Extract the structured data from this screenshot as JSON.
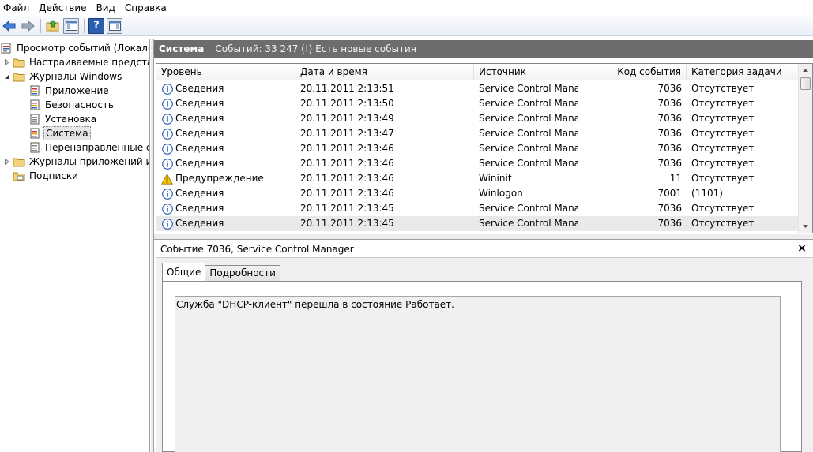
{
  "menu": [
    "Файл",
    "Действие",
    "Вид",
    "Справка"
  ],
  "toolbar": {
    "back_icon": "back-arrow-icon",
    "forward_icon": "forward-arrow-icon",
    "up_icon": "up-folder-icon",
    "show_hide_tree_icon": "console-tree-icon",
    "help_icon": "help-icon",
    "action_pane_icon": "action-pane-icon"
  },
  "tree": {
    "root": "Просмотр событий (Локальный)",
    "custom_views": "Настраиваемые представления",
    "windows_logs": "Журналы Windows",
    "application": "Приложение",
    "security": "Безопасность",
    "setup": "Установка",
    "system": "Система",
    "forwarded": "Перенаправленные события",
    "app_logs": "Журналы приложений и служб",
    "subscriptions": "Подписки"
  },
  "header": {
    "title": "Система",
    "status": "Событий: 33 247 (!) Есть новые события"
  },
  "columns": [
    "Уровень",
    "Дата и время",
    "Источник",
    "Код события",
    "Категория задачи"
  ],
  "rows": [
    {
      "level": "Сведения",
      "type": "info",
      "date": "20.11.2011 2:13:51",
      "source": "Service Control Mana...",
      "code": "7036",
      "category": "Отсутствует"
    },
    {
      "level": "Сведения",
      "type": "info",
      "date": "20.11.2011 2:13:50",
      "source": "Service Control Mana...",
      "code": "7036",
      "category": "Отсутствует"
    },
    {
      "level": "Сведения",
      "type": "info",
      "date": "20.11.2011 2:13:49",
      "source": "Service Control Mana...",
      "code": "7036",
      "category": "Отсутствует"
    },
    {
      "level": "Сведения",
      "type": "info",
      "date": "20.11.2011 2:13:47",
      "source": "Service Control Mana...",
      "code": "7036",
      "category": "Отсутствует"
    },
    {
      "level": "Сведения",
      "type": "info",
      "date": "20.11.2011 2:13:46",
      "source": "Service Control Mana...",
      "code": "7036",
      "category": "Отсутствует"
    },
    {
      "level": "Сведения",
      "type": "info",
      "date": "20.11.2011 2:13:46",
      "source": "Service Control Mana...",
      "code": "7036",
      "category": "Отсутствует"
    },
    {
      "level": "Предупреждение",
      "type": "warning",
      "date": "20.11.2011 2:13:46",
      "source": "Wininit",
      "code": "11",
      "category": "Отсутствует"
    },
    {
      "level": "Сведения",
      "type": "info",
      "date": "20.11.2011 2:13:46",
      "source": "Winlogon",
      "code": "7001",
      "category": "(1101)"
    },
    {
      "level": "Сведения",
      "type": "info",
      "date": "20.11.2011 2:13:45",
      "source": "Service Control Mana...",
      "code": "7036",
      "category": "Отсутствует"
    },
    {
      "level": "Сведения",
      "type": "info",
      "date": "20.11.2011 2:13:45",
      "source": "Service Control Mana...",
      "code": "7036",
      "category": "Отсутствует"
    }
  ],
  "selected_row": 9,
  "detail": {
    "title": "Событие 7036, Service Control Manager",
    "close": "×",
    "tab_general": "Общие",
    "tab_details": "Подробности",
    "message": "Служба \"DHCP-клиент\" перешла в состояние Работает."
  },
  "colors": {
    "header_bg": "#6d6d6d",
    "info_icon": "#2b5fb4",
    "warning_icon": "#f4c20d",
    "selected_row": "#e9e9e9"
  }
}
